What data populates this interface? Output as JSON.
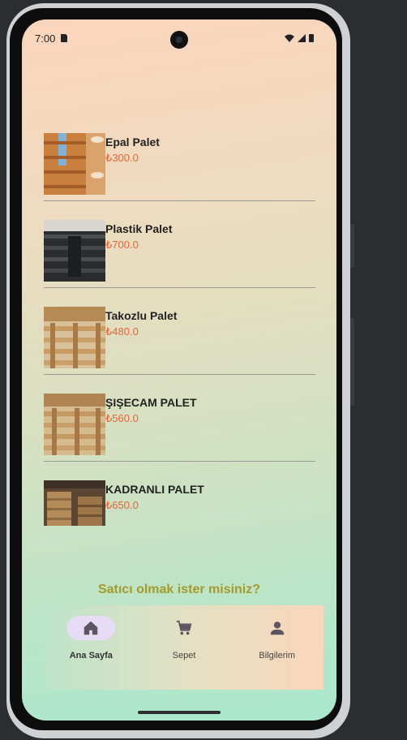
{
  "status_bar": {
    "time": "7:00"
  },
  "products": [
    {
      "name": "Epal Palet",
      "price": "₺300.0"
    },
    {
      "name": "Plastik Palet",
      "price": "₺700.0"
    },
    {
      "name": "Takozlu Palet",
      "price": "₺480.0"
    },
    {
      "name": "ŞIŞECAM PALET",
      "price": "₺560.0"
    },
    {
      "name": "KADRANLI PALET",
      "price": "₺650.0"
    }
  ],
  "seller_prompt": "Satıcı olmak ister misiniz?",
  "bottom_nav": [
    {
      "label": "Ana Sayfa",
      "icon": "home-icon",
      "active": true
    },
    {
      "label": "Sepet",
      "icon": "cart-icon",
      "active": false
    },
    {
      "label": "Bilgilerim",
      "icon": "person-icon",
      "active": false
    }
  ],
  "colors": {
    "price": "#e8653a",
    "seller_link": "#a59a2c",
    "active_pill": "#e6dcf5"
  }
}
